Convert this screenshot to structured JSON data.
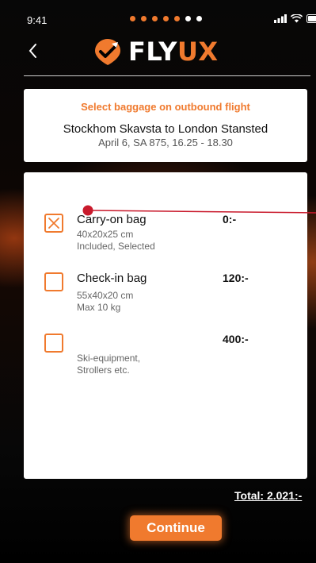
{
  "status_bar": {
    "time": "9:41"
  },
  "pager": {
    "total": 7,
    "active": 5
  },
  "brand": {
    "fly": "FLY",
    "ux": "UX",
    "accent_color": "#f07a2e"
  },
  "flight": {
    "heading": "Select baggage on outbound flight",
    "route": "Stockhom Skavsta to London Stansted",
    "details": "April 6, SA 875, 16.25 - 18.30"
  },
  "baggage": [
    {
      "name": "Carry-on bag",
      "price": "0:-",
      "detail1": "40x20x25 cm",
      "detail2": "Included, Selected",
      "checked": true
    },
    {
      "name": "Check-in bag",
      "price": "120:-",
      "detail1": "55x40x20 cm",
      "detail2": "Max 10 kg",
      "checked": false
    },
    {
      "name": "",
      "price": "400:-",
      "detail1": "Ski-equipment,",
      "detail2": "Strollers etc.",
      "checked": false
    }
  ],
  "total": "Total: 2.021:-",
  "continue_label": "Continue",
  "icons": [
    "back-chevron-icon",
    "plane-check-icon",
    "signal-icon",
    "wifi-icon",
    "battery-icon",
    "x-mark-icon"
  ]
}
